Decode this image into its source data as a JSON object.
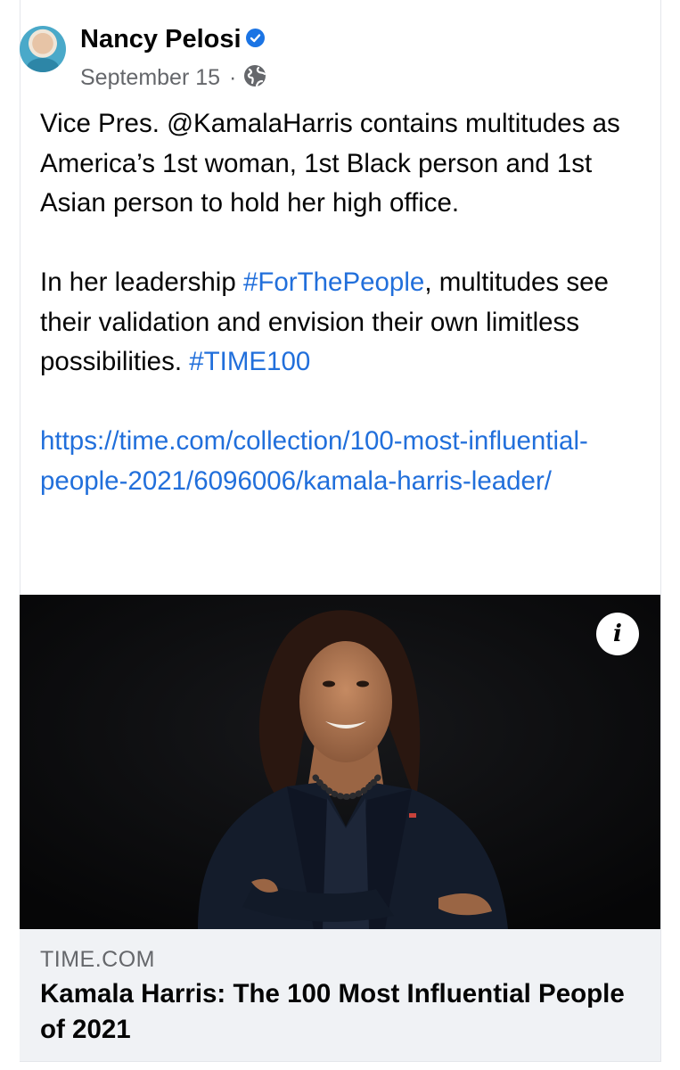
{
  "post": {
    "author": "Nancy Pelosi",
    "date": "September 15",
    "separator": "·",
    "paragraph1": "Vice Pres. @KamalaHarris contains multitudes as America’s 1st woman, 1st Black person and 1st Asian person to hold her high office.",
    "paragraph2_prefix": "In her leadership ",
    "hashtag1": "#ForThePeople",
    "paragraph2_mid": ", multitudes see their validation and envision their own limitless possibilities. ",
    "hashtag2": "#TIME100",
    "url": "https://time.com/collection/100-most-influential-people-2021/6096006/kamala-harris-leader/"
  },
  "link_preview": {
    "domain": "TIME.COM",
    "title": "Kamala Harris: The 100 Most Influential People of 2021",
    "info_icon": "i"
  },
  "colors": {
    "link": "#216fdb",
    "meta_gray": "#65676b",
    "verified_blue": "#1b74e4",
    "preview_bg": "#f0f2f5"
  },
  "icons": [
    "verified-badge-icon",
    "globe-icon",
    "info-icon"
  ]
}
